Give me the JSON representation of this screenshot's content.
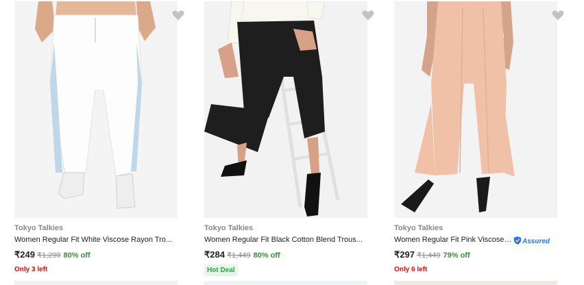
{
  "products": [
    {
      "brand": "Tokyo Talkies",
      "title": "Women Regular Fit White Viscose Rayon Tro...",
      "price": "₹249",
      "mrp": "₹1,299",
      "discount": "80% off",
      "badge": "Only 3 left",
      "badge_type": "stock",
      "assured": false,
      "image_name": "white-trousers-image"
    },
    {
      "brand": "Tokyo Talkies",
      "title": "Women Regular Fit Black Cotton Blend Trous...",
      "price": "₹284",
      "mrp": "₹1,449",
      "discount": "80% off",
      "badge": "Hot Deal",
      "badge_type": "hotdeal",
      "assured": false,
      "image_name": "black-trousers-image"
    },
    {
      "brand": "Tokyo Talkies",
      "title": "Women Regular Fit Pink Viscose ...",
      "price": "₹297",
      "mrp": "₹1,449",
      "discount": "79% off",
      "badge": "Only 6 left",
      "badge_type": "stock",
      "assured": true,
      "assured_label": "Assured",
      "image_name": "pink-trousers-image"
    }
  ],
  "colors": {
    "discount": "#388e3c",
    "stock": "#ff0000",
    "hotdeal": "#26a541",
    "assured": "#2874f0"
  }
}
